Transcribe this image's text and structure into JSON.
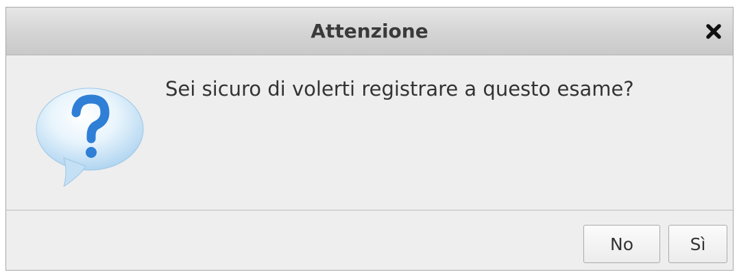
{
  "dialog": {
    "title": "Attenzione",
    "close_icon": "close-icon",
    "icon": "question-icon",
    "message": "Sei sicuro di volerti registrare a questo esame?",
    "buttons": {
      "no_label": "No",
      "yes_label": "Sì"
    }
  },
  "colors": {
    "icon_blue": "#2f7fd6",
    "bubble_light": "#ffffff",
    "bubble_dark": "#b7d9f2"
  }
}
